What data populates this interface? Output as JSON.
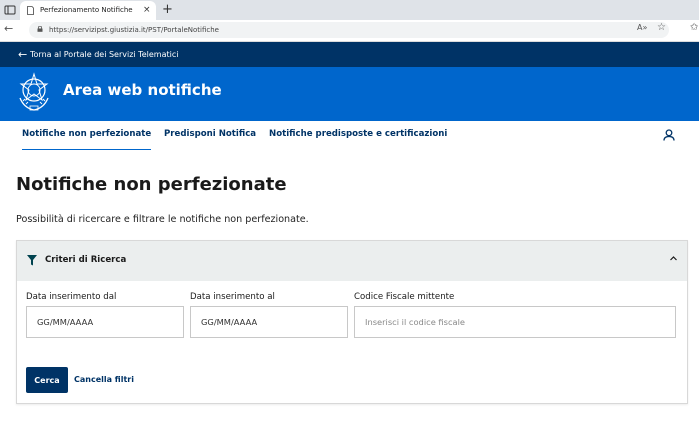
{
  "browser": {
    "tab_title": "Perfezionamento Notifiche",
    "tab_close": "×",
    "new_tab": "+",
    "url": "https://servizipst.giustizia.it/PST/PortaleNotifiche",
    "read_aloud": "A»",
    "favorite": "☆",
    "favorites_bar": "✩"
  },
  "topbar": {
    "back_arrow": "←",
    "back_label": "Torna al Portale dei Servizi Telematici"
  },
  "header": {
    "title": "Area web notifiche"
  },
  "nav": {
    "items": [
      {
        "label": "Notifiche non perfezionate",
        "active": true
      },
      {
        "label": "Predisponi Notifica",
        "active": false
      },
      {
        "label": "Notifiche predisposte e certificazioni",
        "active": false
      }
    ]
  },
  "page": {
    "title": "Notifiche non perfezionate",
    "description": "Possibilità di ricercare e filtrare le notifiche non perfezionate."
  },
  "search_panel": {
    "title": "Criteri di Ricerca",
    "fields": [
      {
        "label": "Data inserimento dal",
        "placeholder": "GG/MM/AAAA",
        "value": ""
      },
      {
        "label": "Data inserimento al",
        "placeholder": "GG/MM/AAAA",
        "value": ""
      },
      {
        "label": "Codice Fiscale mittente",
        "placeholder": "Inserisci il codice fiscale",
        "value": ""
      }
    ],
    "search_label": "Cerca",
    "clear_label": "Cancella filtri"
  },
  "colors": {
    "dark_blue": "#003366",
    "primary_blue": "#0066cc",
    "panel_header": "#ebeeee"
  }
}
